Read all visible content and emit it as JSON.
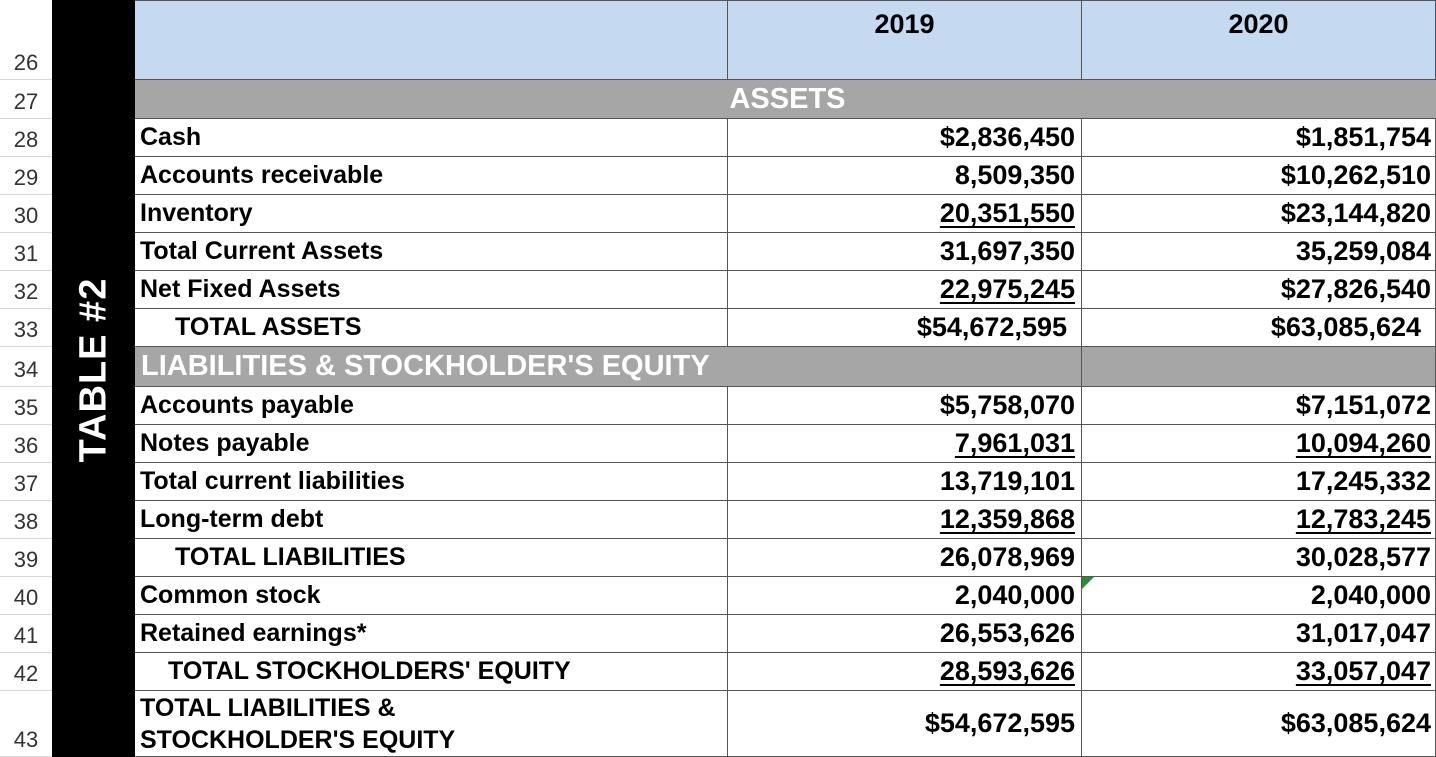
{
  "row_numbers": [
    "26",
    "27",
    "28",
    "29",
    "30",
    "31",
    "32",
    "33",
    "34",
    "35",
    "36",
    "37",
    "38",
    "39",
    "40",
    "41",
    "42",
    "43"
  ],
  "side_label": "TABLE #2",
  "header": {
    "col_2019": "2019",
    "col_2020": "2020"
  },
  "sections": {
    "assets": "ASSETS",
    "liabilities": "LIABILITIES & STOCKHOLDER'S EQUITY"
  },
  "rows": {
    "cash": {
      "label": "Cash",
      "v2019": "$2,836,450",
      "v2020": "$1,851,754"
    },
    "ar": {
      "label": "Accounts receivable",
      "v2019": "8,509,350",
      "v2020": "$10,262,510"
    },
    "inventory": {
      "label": "Inventory",
      "v2019": "20,351,550",
      "v2020": "$23,144,820"
    },
    "tca": {
      "label": "Total Current Assets",
      "v2019": "31,697,350",
      "v2020": "35,259,084"
    },
    "nfa": {
      "label": "Net Fixed Assets",
      "v2019": "22,975,245",
      "v2020": "$27,826,540"
    },
    "total_assets": {
      "label": "TOTAL ASSETS",
      "v2019": "$54,672,595",
      "v2020": "$63,085,624"
    },
    "ap": {
      "label": "Accounts payable",
      "v2019": "$5,758,070",
      "v2020": "$7,151,072"
    },
    "np": {
      "label": "Notes payable",
      "v2019": "7,961,031",
      "v2020": "10,094,260"
    },
    "tcl": {
      "label": "Total current liabilities",
      "v2019": "13,719,101",
      "v2020": "17,245,332"
    },
    "ltd": {
      "label": "Long-term debt",
      "v2019": "12,359,868",
      "v2020": "12,783,245"
    },
    "total_liab": {
      "label": "TOTAL LIABILITIES",
      "v2019": "26,078,969",
      "v2020": "30,028,577"
    },
    "cs": {
      "label": "Common stock",
      "v2019": "2,040,000",
      "v2020": "2,040,000"
    },
    "re": {
      "label": "Retained earnings*",
      "v2019": "26,553,626",
      "v2020": "31,017,047"
    },
    "tse": {
      "label": "TOTAL STOCKHOLDERS' EQUITY",
      "v2019": "28,593,626",
      "v2020": "33,057,047"
    },
    "tle": {
      "label": "TOTAL LIABILITIES & STOCKHOLDER'S EQUITY",
      "v2019": "$54,672,595",
      "v2020": "$63,085,624"
    }
  },
  "colors": {
    "header_fill": "#c5d9f1",
    "section_fill": "#a6a6a6",
    "band": "#000000"
  }
}
